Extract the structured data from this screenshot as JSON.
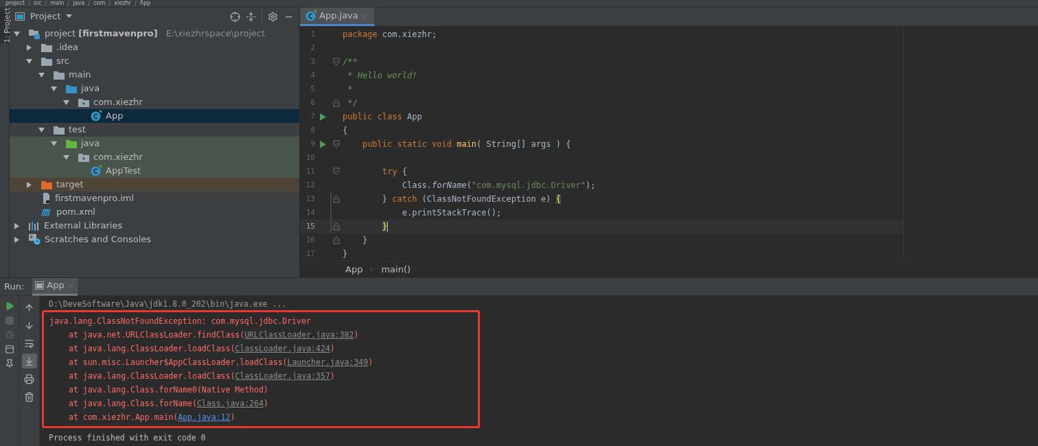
{
  "nav_path": [
    "project",
    "src",
    "main",
    "java",
    "com",
    "xiezhr",
    "App"
  ],
  "tool_windows": [
    {
      "label": "1: Project",
      "selected": true
    }
  ],
  "project_panel": {
    "title": "Project",
    "tree": [
      {
        "label": "project **[firstmavenpro]**",
        "path": "E:\\xiezhrspace\\project",
        "kind": "module",
        "expanded": true,
        "selected": false,
        "test_tint": false,
        "excluded_tint": false,
        "children": [
          {
            "label": ".idea",
            "kind": "folder",
            "expanded": false,
            "selected": false,
            "test_tint": false,
            "excluded_tint": false
          },
          {
            "label": "src",
            "kind": "folder",
            "expanded": true,
            "selected": false,
            "test_tint": false,
            "excluded_tint": false,
            "children": [
              {
                "label": "main",
                "kind": "folder",
                "expanded": true,
                "selected": false,
                "test_tint": false,
                "excluded_tint": false,
                "children": [
                  {
                    "label": "java",
                    "kind": "source-folder",
                    "expanded": true,
                    "selected": false,
                    "test_tint": false,
                    "excluded_tint": false,
                    "children": [
                      {
                        "label": "com.xiezhr",
                        "kind": "package",
                        "expanded": true,
                        "selected": false,
                        "test_tint": false,
                        "excluded_tint": false,
                        "children": [
                          {
                            "label": "App",
                            "kind": "class",
                            "selected": true,
                            "test_tint": false,
                            "excluded_tint": false
                          }
                        ]
                      }
                    ]
                  }
                ]
              },
              {
                "label": "test",
                "kind": "folder",
                "expanded": true,
                "selected": false,
                "test_tint": false,
                "excluded_tint": false,
                "children": [
                  {
                    "label": "java",
                    "kind": "test-folder",
                    "expanded": true,
                    "selected": false,
                    "test_tint": true,
                    "excluded_tint": false,
                    "children": [
                      {
                        "label": "com.xiezhr",
                        "kind": "package",
                        "expanded": true,
                        "selected": false,
                        "test_tint": true,
                        "excluded_tint": false,
                        "children": [
                          {
                            "label": "AppTest",
                            "kind": "class",
                            "selected": false,
                            "test_tint": true,
                            "excluded_tint": false
                          }
                        ]
                      }
                    ]
                  }
                ]
              }
            ]
          },
          {
            "label": "target",
            "kind": "excluded-folder",
            "expanded": false,
            "selected": false,
            "test_tint": false,
            "excluded_tint": true
          },
          {
            "label": "firstmavenpro.iml",
            "kind": "iml-file",
            "selected": false,
            "test_tint": false,
            "excluded_tint": false
          },
          {
            "label": "pom.xml",
            "kind": "maven-file",
            "selected": false,
            "test_tint": false,
            "excluded_tint": false
          }
        ]
      },
      {
        "label": "External Libraries",
        "kind": "libraries",
        "expanded": false,
        "selected": false,
        "test_tint": false,
        "excluded_tint": false
      },
      {
        "label": "Scratches and Consoles",
        "kind": "scratches",
        "expanded": false,
        "selected": false,
        "test_tint": false,
        "excluded_tint": false
      }
    ]
  },
  "editor": {
    "tabs": [
      {
        "label": "App.java",
        "selected": true
      }
    ],
    "lines": [
      {
        "number": "1",
        "run": false,
        "fold_start": false,
        "fold_end": false,
        "changed": false,
        "current": false,
        "tokens": [
          {
            "kind": "keyword",
            "text": "package"
          },
          {
            "kind": "plain",
            "text": " com.xiezhr;"
          }
        ]
      },
      {
        "number": "2",
        "run": false,
        "fold_start": false,
        "fold_end": false,
        "changed": false,
        "current": false
      },
      {
        "number": "3",
        "run": false,
        "fold_start": true,
        "fold_end": false,
        "changed": false,
        "current": false,
        "tokens": [
          {
            "kind": "comment",
            "text": "/**"
          }
        ]
      },
      {
        "number": "4",
        "run": false,
        "fold_start": false,
        "fold_end": false,
        "changed": false,
        "current": false,
        "tokens": [
          {
            "kind": "comment",
            "text": " * "
          },
          {
            "kind": "doc",
            "text": "Hello world!"
          }
        ]
      },
      {
        "number": "5",
        "run": false,
        "fold_start": false,
        "fold_end": false,
        "changed": false,
        "current": false,
        "tokens": [
          {
            "kind": "comment",
            "text": " *"
          }
        ]
      },
      {
        "number": "6",
        "run": false,
        "fold_start": false,
        "fold_end": true,
        "changed": false,
        "current": false,
        "tokens": [
          {
            "kind": "comment",
            "text": " */"
          }
        ]
      },
      {
        "number": "7",
        "run": true,
        "fold_start": false,
        "fold_end": false,
        "changed": false,
        "current": false,
        "tokens": [
          {
            "kind": "keyword",
            "text": "public class"
          },
          {
            "kind": "plain",
            "text": " App"
          }
        ]
      },
      {
        "number": "8",
        "run": false,
        "fold_start": false,
        "fold_end": false,
        "changed": false,
        "current": false,
        "tokens": [
          {
            "kind": "plain",
            "text": "{"
          }
        ]
      },
      {
        "number": "9",
        "run": true,
        "fold_start": true,
        "fold_end": false,
        "changed": false,
        "current": false,
        "tokens": [
          {
            "kind": "keyword",
            "text": "    public static void "
          },
          {
            "kind": "method",
            "text": "main"
          },
          {
            "kind": "plain",
            "text": "( String[] args ) {"
          }
        ]
      },
      {
        "number": "10",
        "run": false,
        "fold_start": false,
        "fold_end": false,
        "changed": false,
        "current": false
      },
      {
        "number": "11",
        "run": false,
        "fold_start": true,
        "fold_end": false,
        "changed": false,
        "current": false,
        "tokens": [
          {
            "kind": "keyword",
            "text": "        try"
          },
          {
            "kind": "plain",
            "text": " {"
          }
        ]
      },
      {
        "number": "12",
        "run": false,
        "fold_start": false,
        "fold_end": false,
        "changed": false,
        "current": false,
        "tokens": [
          {
            "kind": "plain",
            "text": "            Class."
          },
          {
            "kind": "static",
            "text": "forName"
          },
          {
            "kind": "plain",
            "text": "("
          },
          {
            "kind": "string",
            "text": "\"com.mysql.jdbc.Driver\""
          },
          {
            "kind": "plain",
            "text": ");"
          }
        ]
      },
      {
        "number": "13",
        "run": false,
        "fold_start": false,
        "fold_end": true,
        "changed": true,
        "current": false,
        "tokens": [
          {
            "kind": "plain",
            "text": "        } "
          },
          {
            "kind": "keyword",
            "text": "catch"
          },
          {
            "kind": "plain",
            "text": " (ClassNotFoundException e) "
          },
          {
            "kind": "brace",
            "text": "{"
          }
        ]
      },
      {
        "number": "14",
        "run": false,
        "fold_start": false,
        "fold_end": false,
        "changed": true,
        "current": false,
        "tokens": [
          {
            "kind": "plain",
            "text": "            e.printStackTrace();"
          }
        ]
      },
      {
        "number": "15",
        "run": false,
        "fold_start": false,
        "fold_end": true,
        "changed": true,
        "current": true,
        "tokens": [
          {
            "kind": "brace",
            "text": "        }"
          }
        ]
      },
      {
        "number": "16",
        "run": false,
        "fold_start": false,
        "fold_end": true,
        "changed": false,
        "current": false,
        "tokens": [
          {
            "kind": "plain",
            "text": "    }"
          }
        ]
      },
      {
        "number": "17",
        "run": false,
        "fold_start": false,
        "fold_end": false,
        "changed": false,
        "current": false,
        "tokens": [
          {
            "kind": "plain",
            "text": "}"
          }
        ]
      }
    ],
    "breadcrumbs": [
      "App",
      "main()"
    ]
  },
  "run_panel": {
    "label": "Run:",
    "tabs": [
      {
        "label": "App",
        "selected": true
      }
    ],
    "primary_tools": [
      {
        "kind": "rerun",
        "disabled": false
      },
      {
        "kind": "stop",
        "disabled": true
      },
      {
        "kind": "debug",
        "disabled": true
      },
      {
        "kind": "layout",
        "disabled": false
      },
      {
        "kind": "pin",
        "disabled": false
      }
    ],
    "secondary_tools": [
      {
        "kind": "up",
        "active": false
      },
      {
        "kind": "down",
        "active": false
      },
      {
        "kind": "wrap",
        "active": false
      },
      {
        "kind": "scroll-end",
        "active": true
      },
      {
        "kind": "print",
        "active": false
      },
      {
        "kind": "trash",
        "active": false
      }
    ],
    "command": "D:\\DeveSoftware\\Java\\jdk1.8.0_202\\bin\\java.exe ...",
    "output": [
      {
        "kind": "exception",
        "text": "java.lang.ClassNotFoundException: com.mysql.jdbc.Driver"
      },
      {
        "kind": "frame",
        "text": "at java.net.URLClassLoader.findClass(",
        "link": "URLClassLoader.java:382",
        "project_link": false,
        "after": ")"
      },
      {
        "kind": "frame",
        "text": "at java.lang.ClassLoader.loadClass(",
        "link": "ClassLoader.java:424",
        "project_link": false,
        "after": ")"
      },
      {
        "kind": "frame",
        "text": "at sun.misc.Launcher$AppClassLoader.loadClass(",
        "link": "Launcher.java:349",
        "project_link": false,
        "after": ")"
      },
      {
        "kind": "frame",
        "text": "at java.lang.ClassLoader.loadClass(",
        "link": "ClassLoader.java:357",
        "project_link": false,
        "after": ")"
      },
      {
        "kind": "frame",
        "text": "at java.lang.Class.forName0(Native Method)"
      },
      {
        "kind": "frame",
        "text": "at java.lang.Class.forName(",
        "link": "Class.java:264",
        "project_link": false,
        "after": ")"
      },
      {
        "kind": "frame",
        "text": "at com.xiezhr.App.main(",
        "link": "App.java:12",
        "project_link": true,
        "after": ")"
      }
    ],
    "status_line": "Process finished with exit code 0"
  }
}
